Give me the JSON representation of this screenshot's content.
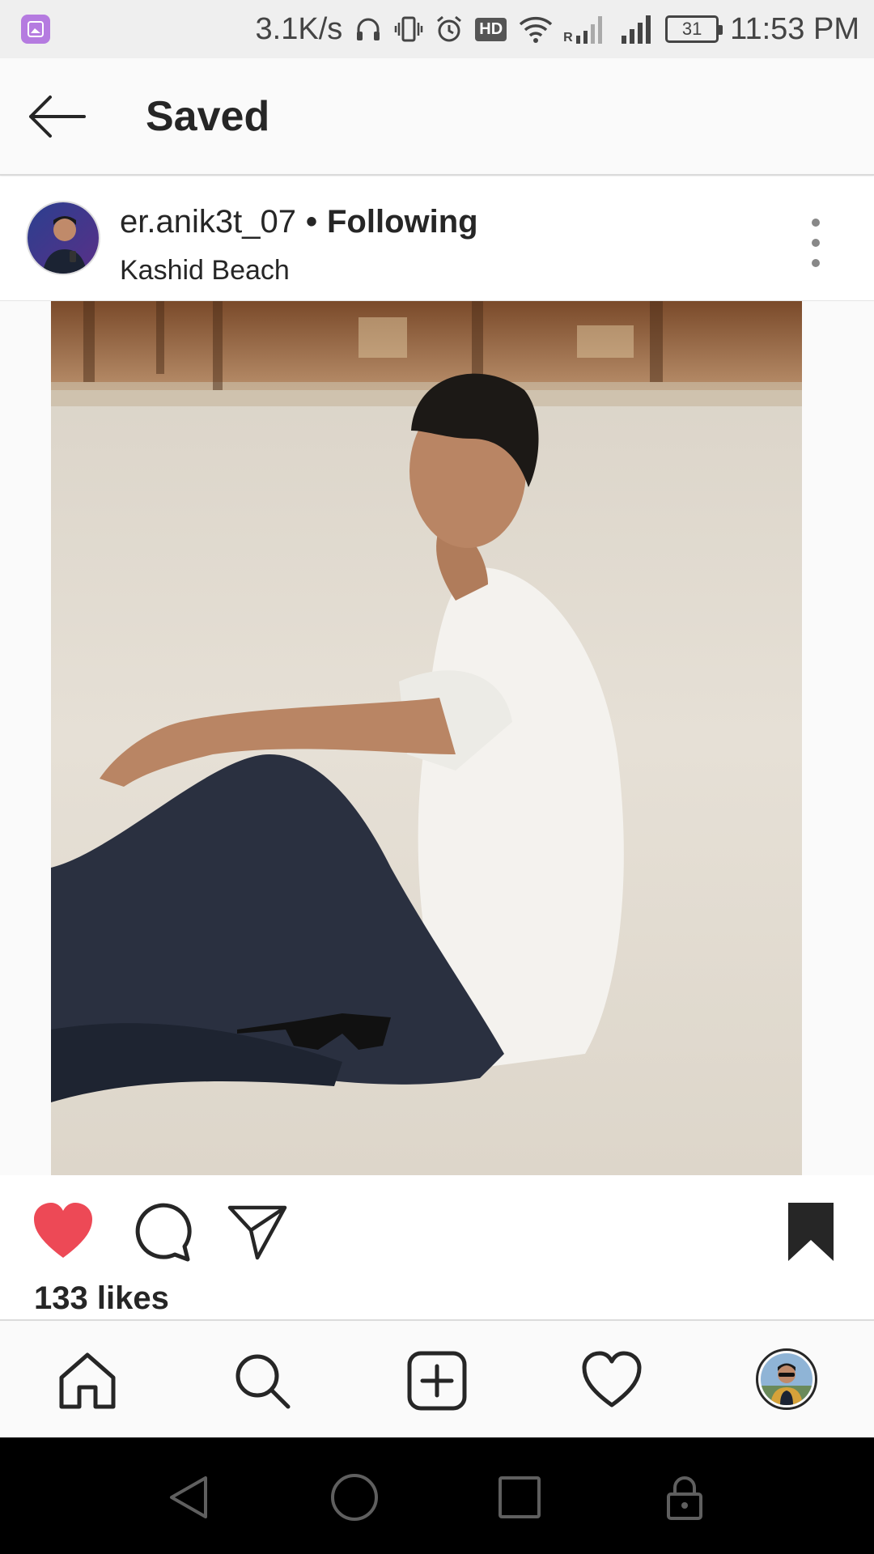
{
  "status_bar": {
    "net_speed": "3.1K/s",
    "hd_label": "HD",
    "roaming_label": "R",
    "battery": "31",
    "time": "11:53 PM"
  },
  "header": {
    "title": "Saved"
  },
  "post": {
    "username": "er.anik3t_07",
    "separator": "•",
    "follow_status": "Following",
    "location": "Kashid Beach",
    "likes_text": "133 likes",
    "liked": true,
    "saved": true
  },
  "colors": {
    "like_red": "#ed4956",
    "text": "#262626",
    "background": "#fafafa"
  },
  "icons": {
    "back": "arrow-left-icon",
    "more": "vertical-dots-icon",
    "like": "heart-filled-icon",
    "comment": "comment-bubble-icon",
    "share": "paper-plane-icon",
    "save": "bookmark-filled-icon",
    "home": "home-icon",
    "search": "search-icon",
    "add": "plus-square-icon",
    "activity": "heart-outline-icon",
    "system_back": "triangle-back-icon",
    "system_home": "circle-home-icon",
    "system_recents": "square-recents-icon",
    "system_lock": "lock-icon"
  }
}
